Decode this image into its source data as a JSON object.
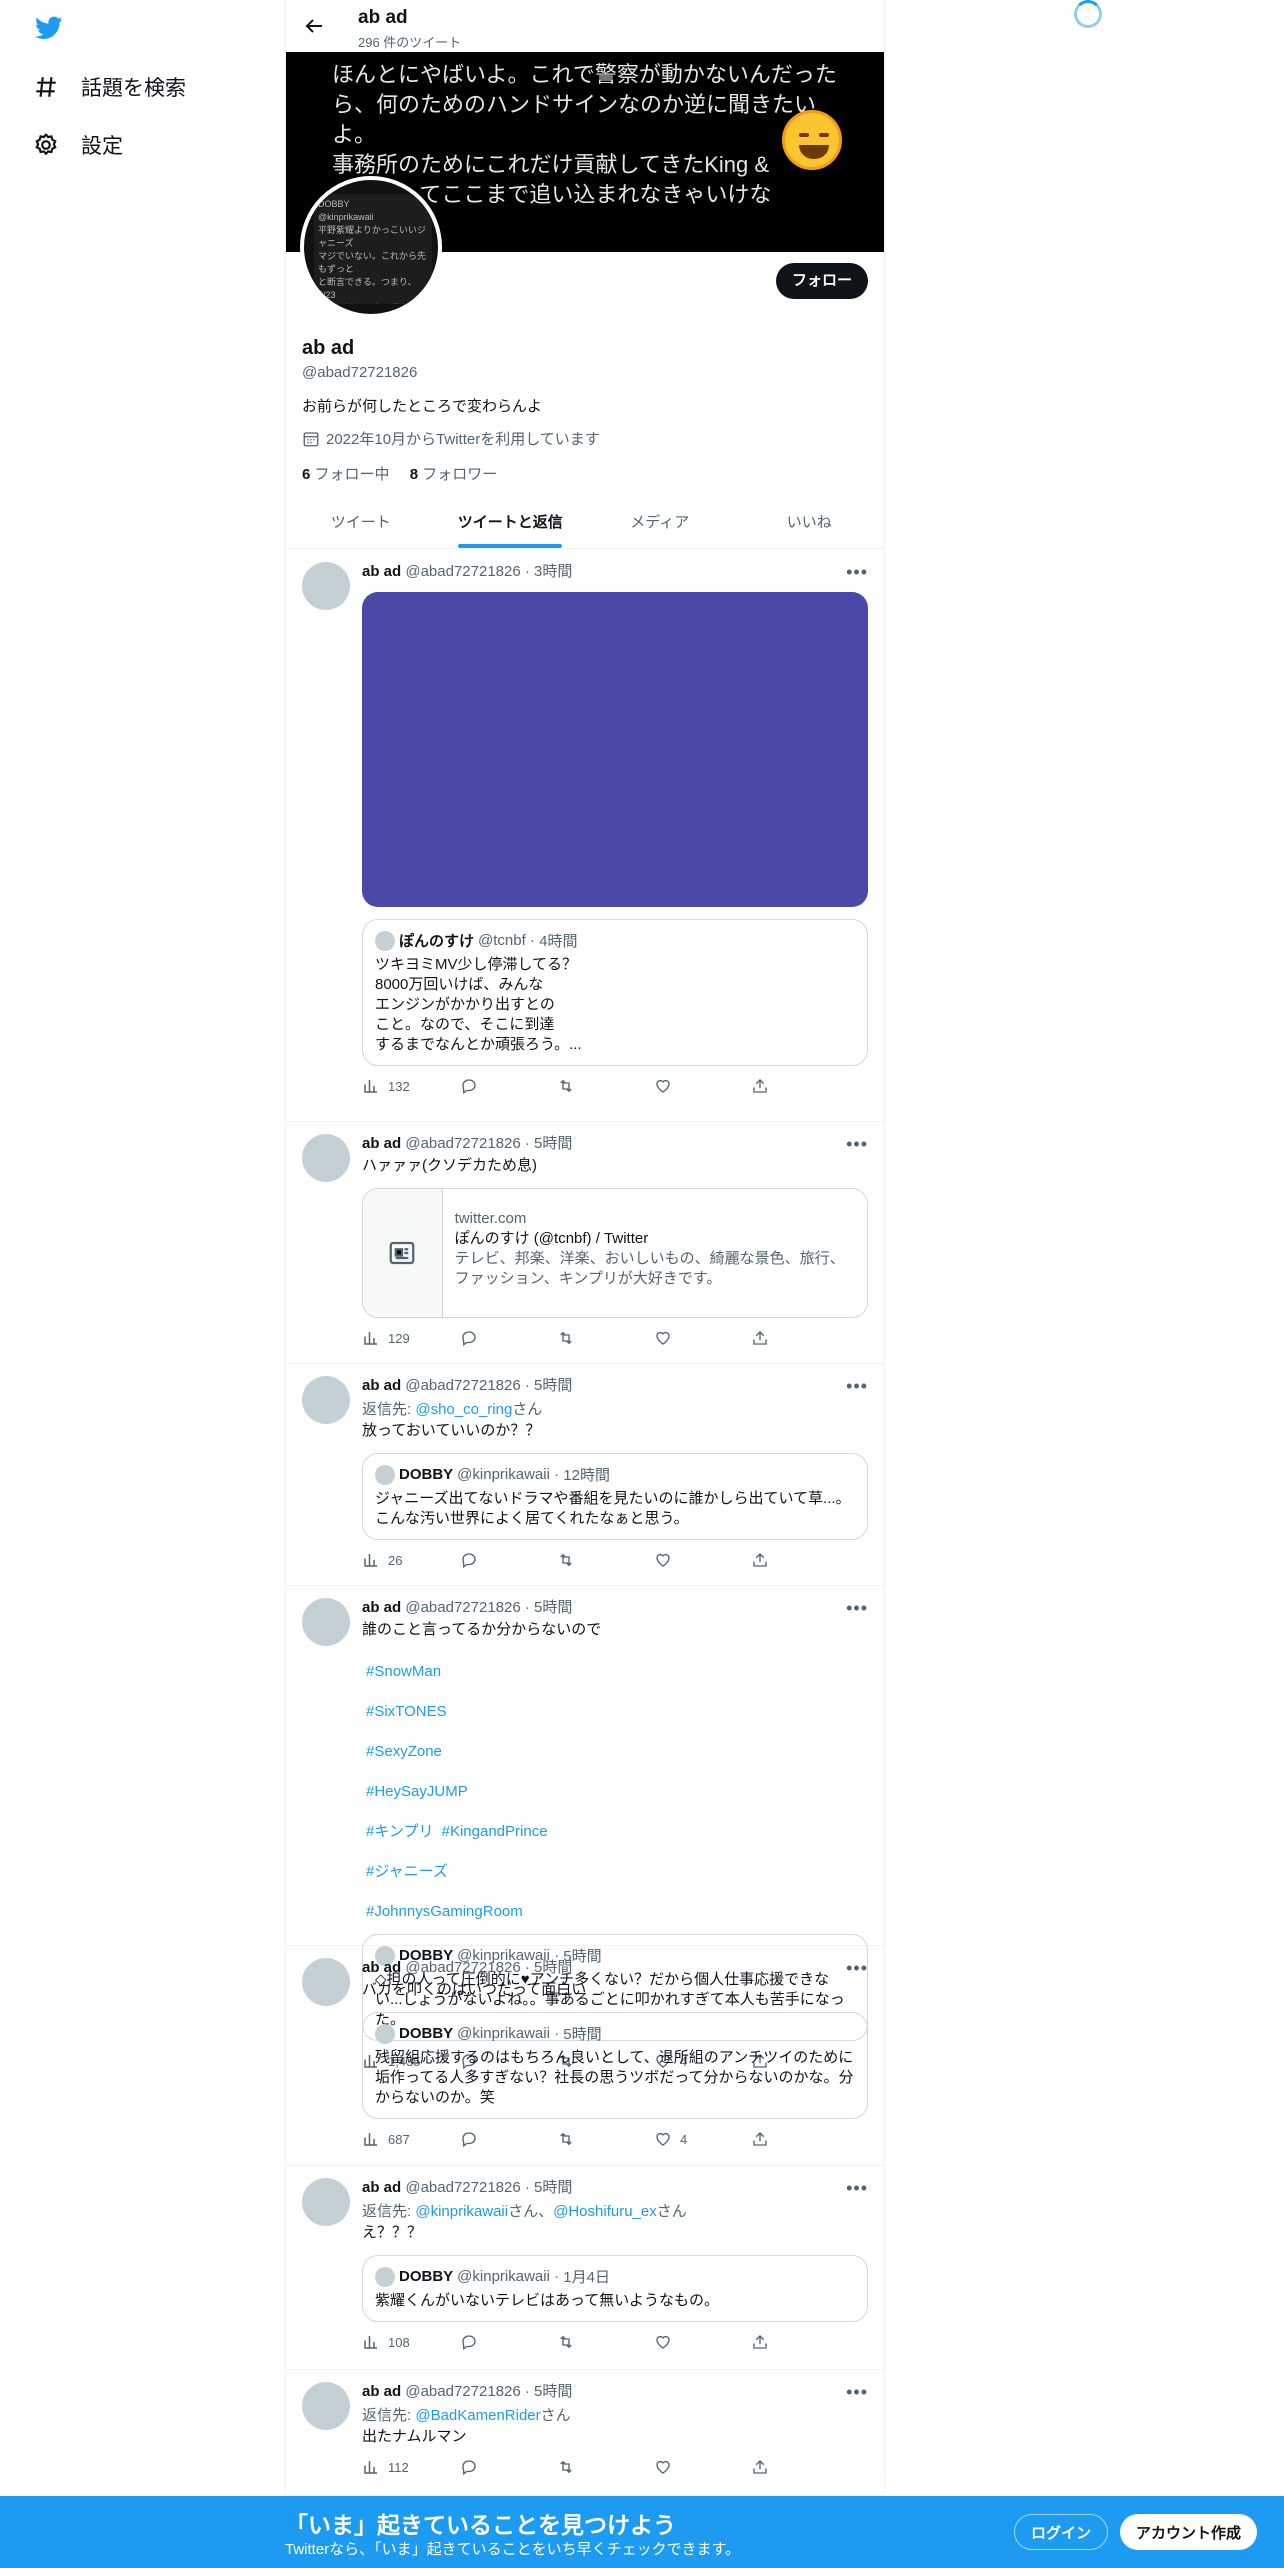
{
  "nav": {
    "explore_label": "話題を検索",
    "settings_label": "設定"
  },
  "header": {
    "name": "ab ad",
    "tweet_count": "296 件のツイート"
  },
  "banner": {
    "text": "ほんとにやばいよ。これで警察が動かないんだったら、何のためのハンドサインなのか逆に聞きたいよ。\n事務所のためにこれだけ貢献してきたKing &\nがどうしてここまで追い込まれなきゃいけな"
  },
  "avatar": {
    "text": "DOBBY\n@kinprikawaii\n平野紫耀よりかっこいいジャニーズ\nマジでいない。これから先もずっと\nと断言できる。つまり、5/23\n一ズとはサヨナラ👋この日が\n来たい..."
  },
  "profile": {
    "follow_label": "フォロー",
    "name": "ab ad",
    "handle": "@abad72721826",
    "bio": "お前らが何したところで変わらんよ",
    "joined": "2022年10月からTwitterを利用しています",
    "following_count": "6",
    "following_label": "フォロー中",
    "followers_count": "8",
    "followers_label": "フォロワー"
  },
  "tabs": [
    "ツイート",
    "ツイートと返信",
    "メディア",
    "いいね"
  ],
  "tweets": [
    {
      "name": "ab ad",
      "handle": "@abad72721826",
      "time": "3時間",
      "media_color": "#4b49a8",
      "quote": {
        "name": "ぽんのすけ",
        "handle": "@tcnbf",
        "time": "4時間",
        "text": "ツキヨミMV少し停滞してる？\n8000万回いけば、みんな\nエンジンがかかり出すとの\nこと。なので、そこに到達\nするまでなんとか頑張ろう。..."
      },
      "views": "132",
      "likes": ""
    },
    {
      "name": "ab ad",
      "handle": "@abad72721826",
      "time": "5時間",
      "text": "ハァァァ(クソデカため息)",
      "card": {
        "domain": "twitter.com",
        "title": "ぽんのすけ (@tcnbf) / Twitter",
        "desc": "テレビ、邦楽、洋楽、おいしいもの、綺麗な景色、旅行、ファッション、キンプリが大好きです。"
      },
      "views": "129",
      "likes": ""
    },
    {
      "name": "ab ad",
      "handle": "@abad72721826",
      "time": "5時間",
      "reply_prefix": "返信先: ",
      "reply_to": "@sho_co_ring",
      "reply_suffix": "さん",
      "text": "放っておいていいのか？？",
      "quote": {
        "name": "DOBBY",
        "handle": "@kinprikawaii",
        "time": "12時間",
        "text": "ジャニーズ出てないドラマや番組を見たいのに誰かしら出ていて草...。\nこんな汚い世界によく居てくれたなぁと思う。"
      },
      "views": "26",
      "likes": ""
    },
    {
      "name": "ab ad",
      "handle": "@abad72721826",
      "time": "5時間",
      "text": "誰のこと言ってるか分からないので",
      "hashtags": [
        "#SnowMan",
        "#SixTONES",
        "#SexyZone",
        "#HeySayJUMP",
        "#キンプリ",
        "#KingandPrince",
        "#ジャニーズ",
        "#JohnnysGamingRoom"
      ],
      "quote": {
        "name": "DOBBY",
        "handle": "@kinprikawaii",
        "time": "5時間",
        "text": "◇担の人って圧倒的に♥アンチ多くない？だから個人仕事応援できない...しょうがないよね。。事あるごとに叩かれすぎて本人も苦手になった。"
      },
      "views": "1,435",
      "likes": "4"
    },
    {
      "name": "ab ad",
      "handle": "@abad72721826",
      "time": "5時間",
      "text": "バカを叩くのはいつだって面白い",
      "quote": {
        "name": "DOBBY",
        "handle": "@kinprikawaii",
        "time": "5時間",
        "text": "残留組応援するのはもちろん良いとして、退所組のアンチツイのために垢作ってる人多すぎない？社長の思うツボだって分からないのかな。分からないのか。笑"
      },
      "views": "687",
      "likes": "4"
    },
    {
      "name": "ab ad",
      "handle": "@abad72721826",
      "time": "5時間",
      "reply_prefix": "返信先: ",
      "reply_to": "@kinprikawaii",
      "reply_mid": "さん、",
      "reply_to2": "@Hoshifuru_ex",
      "reply_suffix": "さん",
      "text": "え？？？",
      "quote": {
        "name": "DOBBY",
        "handle": "@kinprikawaii",
        "time": "1月4日",
        "text": "紫耀くんがいないテレビはあって無いようなもの。"
      },
      "views": "108",
      "likes": ""
    },
    {
      "name": "ab ad",
      "handle": "@abad72721826",
      "time": "5時間",
      "reply_prefix": "返信先: ",
      "reply_to": "@BadKamenRider",
      "reply_suffix": "さん",
      "text": "出たナムルマン",
      "views": "112",
      "likes": ""
    }
  ],
  "bottom": {
    "title": "「いま」起きていることを見つけよう",
    "subtitle": "Twitterなら、「いま」起きていることをいち早くチェックできます。",
    "login_label": "ログイン",
    "signup_label": "アカウント作成"
  },
  "colors": {
    "accent": "#1d9bf0",
    "dark": "#0f1419",
    "muted": "#536471"
  }
}
